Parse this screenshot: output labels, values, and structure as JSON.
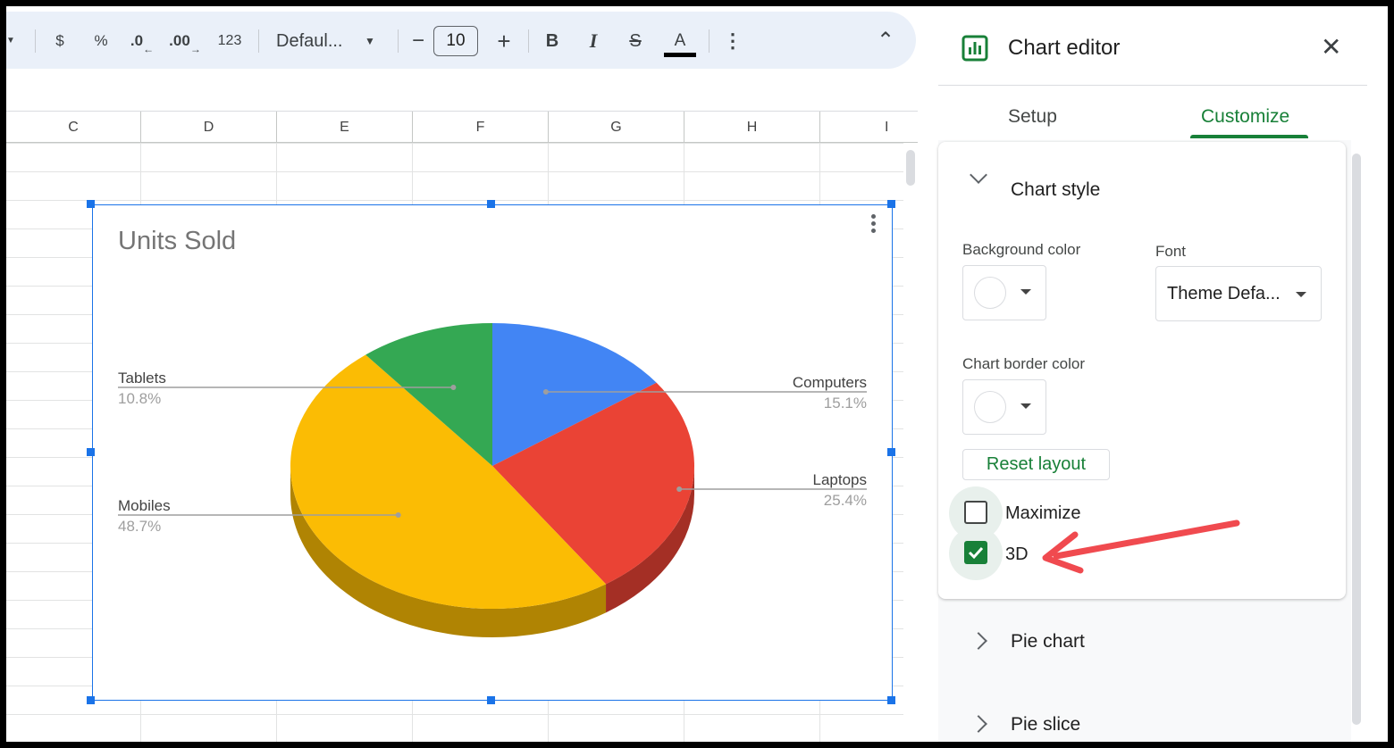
{
  "toolbar": {
    "currency": "$",
    "percent": "%",
    "decrease_decimal": ".0",
    "increase_decimal": ".00",
    "number_format": "123",
    "font_family": "Defaul...",
    "font_size": "10",
    "decrease_size": "−",
    "increase_size": "+",
    "bold": "B",
    "italic": "I",
    "strikethrough": "S",
    "text_color": "A",
    "more": "⋮",
    "collapse": "⌃"
  },
  "columns": [
    "C",
    "D",
    "E",
    "F",
    "G",
    "H",
    "I"
  ],
  "chart": {
    "title": "Units Sold",
    "menu": "⋮"
  },
  "chart_data": {
    "type": "pie",
    "title": "Units Sold",
    "is_3d": true,
    "legend": "labeled",
    "slices": [
      {
        "label": "Computers",
        "percent_label": "15.1%",
        "value": 15.1,
        "color": "#4285f4"
      },
      {
        "label": "Laptops",
        "percent_label": "25.4%",
        "value": 25.4,
        "color": "#ea4335"
      },
      {
        "label": "Mobiles",
        "percent_label": "48.7%",
        "value": 48.7,
        "color": "#fbbc04"
      },
      {
        "label": "Tablets",
        "percent_label": "10.8%",
        "value": 10.8,
        "color": "#34a853"
      }
    ]
  },
  "panel": {
    "title": "Chart editor",
    "close": "✕",
    "tabs": {
      "setup": "Setup",
      "customize": "Customize"
    },
    "section": "Chart style",
    "background_color_label": "Background color",
    "font_label": "Font",
    "font_value": "Theme Defa...",
    "border_color_label": "Chart border color",
    "reset_layout": "Reset layout",
    "maximize_label": "Maximize",
    "maximize_checked": false,
    "threed_label": "3D",
    "threed_checked": true,
    "pie_chart_section": "Pie chart",
    "pie_slice_section": "Pie slice",
    "accent_color": "#188038",
    "annotation_arrow_color": "#f04a4f"
  }
}
